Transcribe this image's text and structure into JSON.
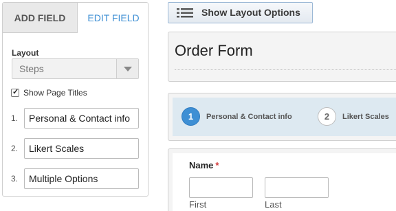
{
  "panel": {
    "tabs": [
      {
        "label": "Add Field"
      },
      {
        "label": "Edit Field"
      }
    ],
    "layout_label": "Layout",
    "layout_select": {
      "value": "Steps"
    },
    "show_page_titles": {
      "label": "Show Page Titles",
      "checked": true
    },
    "pages": [
      {
        "number": "1.",
        "value": "Personal & Contact info"
      },
      {
        "number": "2.",
        "value": "Likert Scales"
      },
      {
        "number": "3.",
        "value": "Multiple Options"
      }
    ]
  },
  "toolbar": {
    "show_layout_label": "Show Layout Options",
    "icon": "list-lines-icon"
  },
  "form": {
    "title": "Order Form",
    "steps": [
      {
        "number": "1",
        "label": "Personal & Contact info",
        "active": true
      },
      {
        "number": "2",
        "label": "Likert Scales",
        "active": false
      }
    ],
    "name_field": {
      "label": "Name",
      "required_marker": "*",
      "first_label": "First",
      "last_label": "Last"
    }
  },
  "colors": {
    "accent": "#3e8fd4",
    "steps_bg": "#dde9f1",
    "required": "#d23a3a"
  }
}
